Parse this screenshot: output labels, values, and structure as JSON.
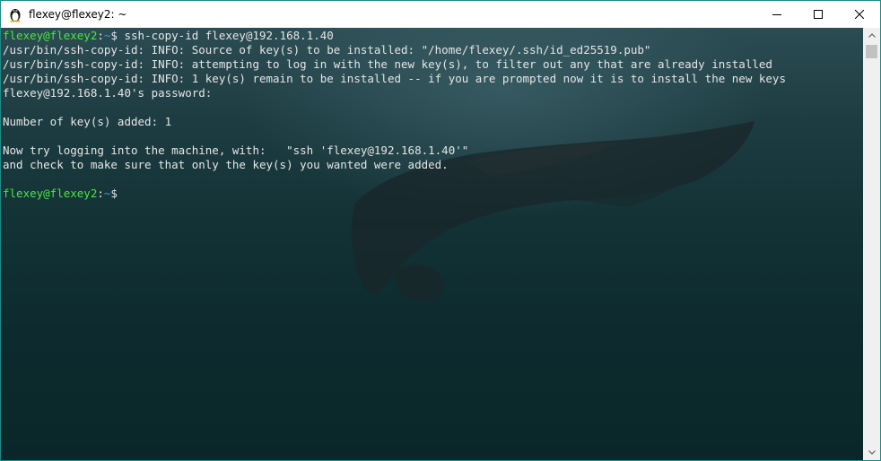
{
  "window": {
    "title": "flexey@flexey2: ~",
    "icon": "linux-penguin-icon",
    "controls": {
      "minimize": "minimize-icon",
      "maximize": "maximize-icon",
      "close": "close-icon"
    }
  },
  "terminal": {
    "prompt1": {
      "user": "flexey@flexey2",
      "sep": ":",
      "path": "~",
      "symbol": "$",
      "command": " ssh-copy-id flexey@192.168.1.40"
    },
    "output": [
      "/usr/bin/ssh-copy-id: INFO: Source of key(s) to be installed: \"/home/flexey/.ssh/id_ed25519.pub\"",
      "/usr/bin/ssh-copy-id: INFO: attempting to log in with the new key(s), to filter out any that are already installed",
      "/usr/bin/ssh-copy-id: INFO: 1 key(s) remain to be installed -- if you are prompted now it is to install the new keys",
      "flexey@192.168.1.40's password:",
      "",
      "Number of key(s) added: 1",
      "",
      "Now try logging into the machine, with:   \"ssh 'flexey@192.168.1.40'\"",
      "and check to make sure that only the key(s) you wanted were added.",
      ""
    ],
    "prompt2": {
      "user": "flexey@flexey2",
      "sep": ":",
      "path": "~",
      "symbol": "$"
    }
  },
  "colors": {
    "prompt_user": "#4ce63f",
    "prompt_path": "#4f8fe6",
    "text": "#e6e6e6",
    "window_border": "#1e8a86"
  },
  "scrollbar": {
    "up_icon": "scroll-up-arrow-icon",
    "down_icon": "scroll-down-arrow-icon"
  }
}
